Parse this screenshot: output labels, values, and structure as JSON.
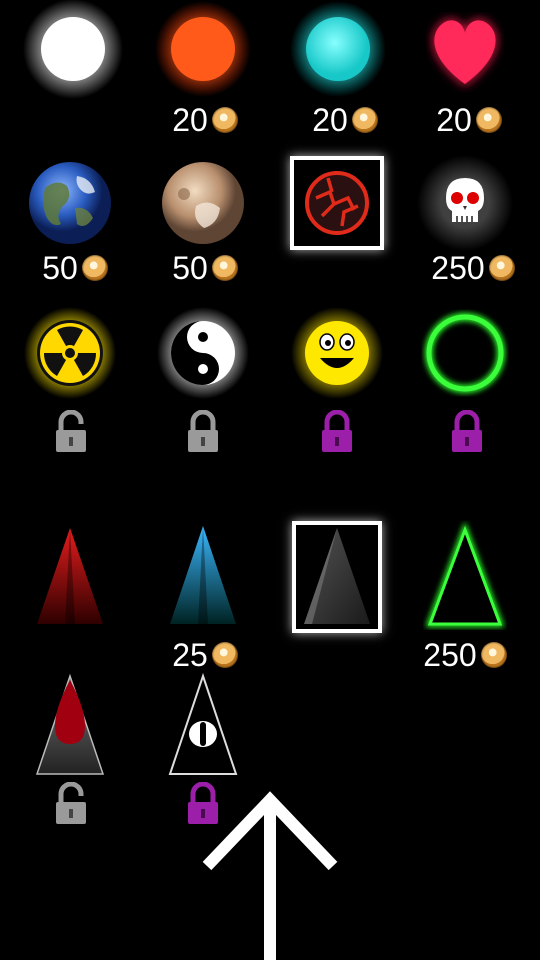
{
  "shop": {
    "balls": [
      {
        "name": "white",
        "price": null
      },
      {
        "name": "orange",
        "price": "20"
      },
      {
        "name": "cyan",
        "price": "20"
      },
      {
        "name": "heart",
        "price": "20"
      },
      {
        "name": "earth",
        "price": "50"
      },
      {
        "name": "pluto",
        "price": "50"
      },
      {
        "name": "lava",
        "price": null,
        "selected": true
      },
      {
        "name": "skull",
        "price": "250"
      },
      {
        "name": "radioactive",
        "lock": "unlocked"
      },
      {
        "name": "yin-yang",
        "lock": "locked-gray"
      },
      {
        "name": "smiley",
        "lock": "locked-purple"
      },
      {
        "name": "green-ring",
        "lock": "locked-purple"
      }
    ],
    "spikes": [
      {
        "name": "red-spike",
        "price": null
      },
      {
        "name": "blue-spike",
        "price": "25"
      },
      {
        "name": "gray-spike",
        "price": null,
        "selected": true
      },
      {
        "name": "green-spike",
        "price": "250"
      },
      {
        "name": "blood-spike",
        "lock": "unlocked"
      },
      {
        "name": "eye-spike",
        "lock": "locked-purple"
      }
    ]
  },
  "colors": {
    "background": "#000000",
    "lock_gray": "#9a9a9a",
    "lock_purple": "#9b1fa8",
    "coin": "#e0a040"
  },
  "icons": {
    "coin": "coin-icon",
    "lock_open": "unlock-icon",
    "lock_closed": "lock-icon",
    "back": "up-arrow-icon"
  }
}
